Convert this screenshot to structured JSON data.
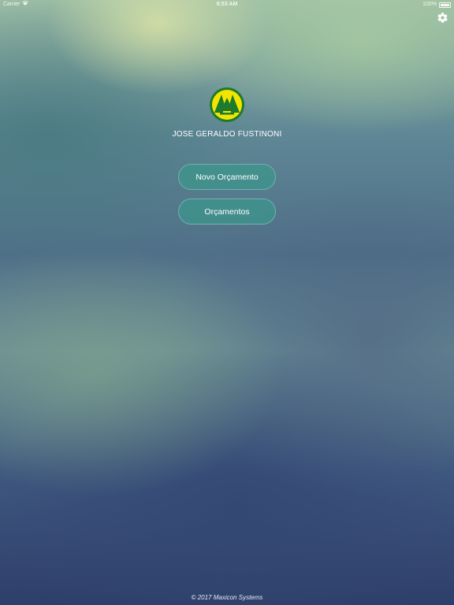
{
  "status_bar": {
    "carrier": "Carrier",
    "time": "6:53 AM",
    "battery": "100%",
    "battery_level": 1.0
  },
  "header": {
    "settings_icon": "gear-icon"
  },
  "logo": {
    "icon": "pine-trees-logo",
    "colors": {
      "ring": "#1e7a2c",
      "fill": "#f2e600",
      "trees": "#1e7a2c"
    }
  },
  "user": {
    "name": "JOSE GERALDO FUSTINONI"
  },
  "menu": {
    "new_budget_label": "Novo Orçamento",
    "budgets_label": "Orçamentos",
    "button_color": "#3c968c"
  },
  "footer": {
    "copyright": "© 2017 Maxicon Systems"
  }
}
